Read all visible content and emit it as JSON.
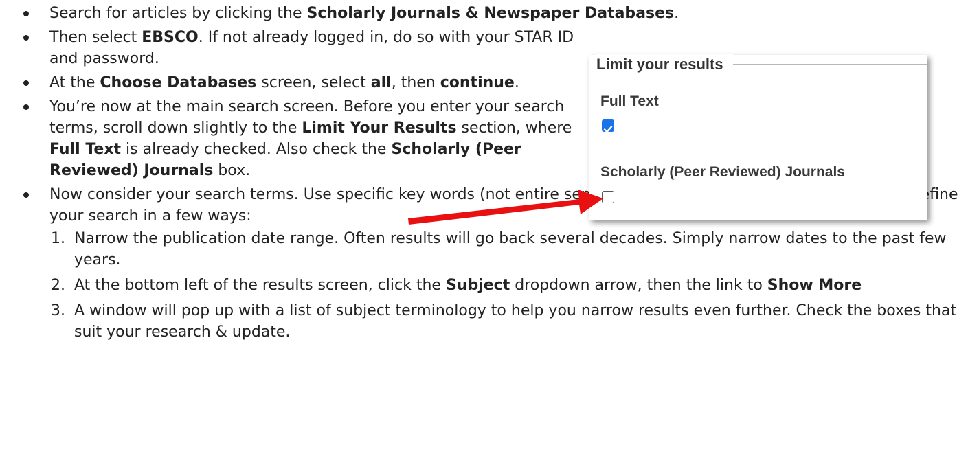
{
  "instructions": {
    "b1": {
      "pre": "Search for articles by clicking the ",
      "bold": "Scholarly Journals & Newspaper Databases",
      "post": "."
    },
    "b2": {
      "pre": "Then select ",
      "bold": "EBSCO",
      "post": ". If not already logged in, do so with your STAR ID and password."
    },
    "b3": {
      "pre": "At the ",
      "bold1": "Choose Databases",
      "mid1": " screen, select ",
      "bold2": "all",
      "mid2": ", then ",
      "bold3": "continue",
      "post": "."
    },
    "b4": {
      "pre": "You’re now at the main search screen. Before you enter your search terms, scroll down slightly to the ",
      "bold1": "Limit Your Results",
      "mid1": " section, where ",
      "bold2": "Full Text",
      "mid2": " is already checked. Also check the ",
      "bold3": "Scholarly (Peer Reviewed) Journals",
      "post": " box."
    },
    "b5": {
      "text": "Now consider your search terms. Use specific key words (not entire sentences). From your list of results, you may refine your search in a few ways:"
    },
    "steps": [
      {
        "num": "1.",
        "text": "Narrow the publication date range. Often results will go back several decades. Simply narrow dates to the past few years."
      },
      {
        "num": "2.",
        "pre": "At the bottom left of the results screen, click the ",
        "bold1": "Subject",
        "mid1": " dropdown arrow, then the link to ",
        "bold2": "Show More"
      },
      {
        "num": "3.",
        "text": "A window will pop up with a list of subject terminology to help you narrow results even further. Check the boxes that suit your research & update."
      }
    ]
  },
  "limit_panel": {
    "title": "Limit your results",
    "full_text_label": "Full Text",
    "full_text_checked": true,
    "scholarly_label": "Scholarly (Peer Reviewed) Journals",
    "scholarly_checked": false
  },
  "colors": {
    "arrow": "#e81010",
    "checkbox_checked": "#1a73e8",
    "text": "#222222"
  }
}
